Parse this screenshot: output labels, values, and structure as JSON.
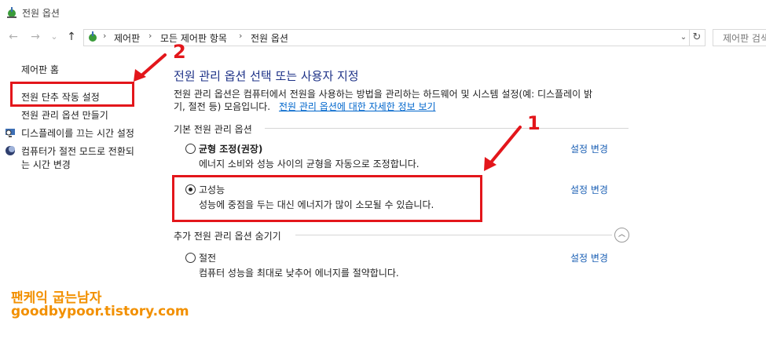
{
  "window": {
    "title": "전원 옵션"
  },
  "nav": {
    "back_icon": "←",
    "forward_icon": "→",
    "recent_icon": "⌄",
    "up_icon": "↑",
    "breadcrumbs": [
      "제어판",
      "모든 제어판 항목",
      "전원 옵션"
    ],
    "refresh_icon": "↻",
    "search_placeholder": "제어판 검색"
  },
  "left_pane": {
    "home": "제어판 홈",
    "links": [
      {
        "label": "전원 단추 작동 설정"
      },
      {
        "label": "전원 관리 옵션 만들기"
      },
      {
        "label": "디스플레이를 끄는 시간 설정"
      },
      {
        "label_line1": "컴퓨터가 절전 모드로 전환되",
        "label_line2": "는 시간 변경"
      }
    ]
  },
  "main": {
    "heading": "전원 관리 옵션 선택 또는 사용자 지정",
    "description_line1": "전원 관리 옵션은 컴퓨터에서 전원을 사용하는 방법을 관리하는 하드웨어 및 시스템 설정(예: 디스플레이 밝",
    "description_line2": "기, 절전 등) 모음입니다.",
    "more_info_link": "전원 관리 옵션에 대한 자세한 정보 보기",
    "preferred_section": "기본 전원 관리 옵션",
    "hidden_section": "추가 전원 관리 옵션 숨기기",
    "plans": [
      {
        "name": "균형 조정(권장)",
        "desc": "에너지 소비와 성능 사이의 균형을 자동으로 조정합니다.",
        "change": "설정 변경",
        "selected": false
      },
      {
        "name": "고성능",
        "desc": "성능에 중점을 두는 대신 에너지가 많이 소모될 수 있습니다.",
        "change": "설정 변경",
        "selected": true
      },
      {
        "name": "절전",
        "desc": "컴퓨터 성능을 최대로 낮추어 에너지를 절약합니다.",
        "change": "설정 변경",
        "selected": false
      }
    ]
  },
  "annotations": {
    "number_1": "1",
    "number_2": "2",
    "accent_color": "#e3161b"
  },
  "watermark": {
    "line1": "팬케익 굽는남자",
    "line2": "goodbypoor.tistory.com",
    "color": "#f29000"
  }
}
